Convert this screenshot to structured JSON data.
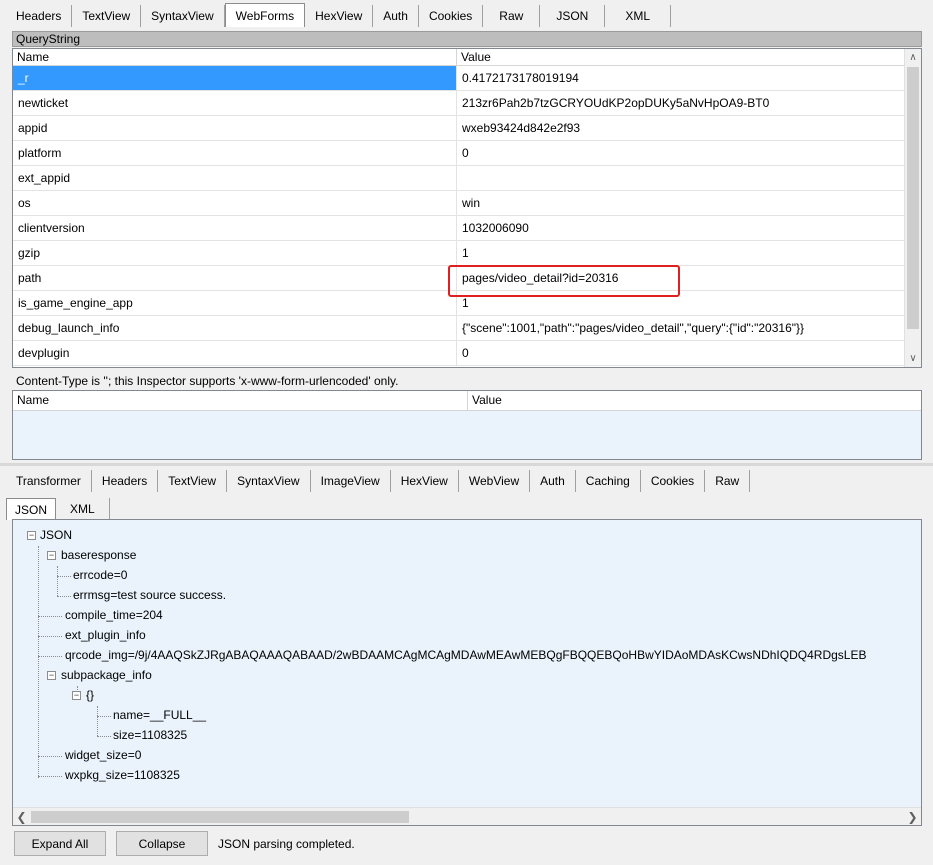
{
  "request_tabs": [
    "Headers",
    "TextView",
    "SyntaxView",
    "WebForms",
    "HexView",
    "Auth",
    "Cookies",
    "Raw",
    "JSON",
    "XML"
  ],
  "request_active_tab": "WebForms",
  "querystring": {
    "title": "QueryString",
    "col_name": "Name",
    "col_value": "Value",
    "rows": [
      {
        "name": "_r",
        "value": "0.4172173178019194"
      },
      {
        "name": "newticket",
        "value": "213zr6Pah2b7tzGCRYOUdKP2opDUKy5aNvHpOA9-BT0"
      },
      {
        "name": "appid",
        "value": "wxeb93424d842e2f93"
      },
      {
        "name": "platform",
        "value": "0"
      },
      {
        "name": "ext_appid",
        "value": ""
      },
      {
        "name": "os",
        "value": "win"
      },
      {
        "name": "clientversion",
        "value": "1032006090"
      },
      {
        "name": "gzip",
        "value": "1"
      },
      {
        "name": "path",
        "value": "pages/video_detail?id=20316"
      },
      {
        "name": "is_game_engine_app",
        "value": "1"
      },
      {
        "name": "debug_launch_info",
        "value": "{\"scene\":1001,\"path\":\"pages/video_detail\",\"query\":{\"id\":\"20316\"}}"
      },
      {
        "name": "devplugin",
        "value": "0"
      }
    ]
  },
  "content_type_note": "Content-Type is ''; this Inspector supports 'x-www-form-urlencoded' only.",
  "body_grid": {
    "col_name": "Name",
    "col_value": "Value"
  },
  "response_tabs_row1": [
    "Transformer",
    "Headers",
    "TextView",
    "SyntaxView",
    "ImageView",
    "HexView",
    "WebView",
    "Auth",
    "Caching",
    "Cookies",
    "Raw"
  ],
  "response_tabs_row2": [
    "JSON",
    "XML"
  ],
  "response_active_tab": "JSON",
  "tree": {
    "root": "JSON",
    "baseresponse": "baseresponse",
    "errcode": "errcode=0",
    "errmsg": "errmsg=test source success.",
    "compile_time": "compile_time=204",
    "ext_plugin_info": "ext_plugin_info",
    "qrcode_img": "qrcode_img=/9j/4AAQSkZJRgABAQAAAQABAAD/2wBDAAMCAgMCAgMDAwMEAwMEBQgFBQQEBQoHBwYIDAoMDAsKCwsNDhIQDQ4RDgsLEB",
    "subpackage_info": "subpackage_info",
    "obj": "{}",
    "name_field": "name=__FULL__",
    "size_field": "size=1108325",
    "widget_size": "widget_size=0",
    "wxpkg_size": "wxpkg_size=1108325"
  },
  "buttons": {
    "expand_all": "Expand All",
    "collapse": "Collapse"
  },
  "status": "JSON parsing completed."
}
